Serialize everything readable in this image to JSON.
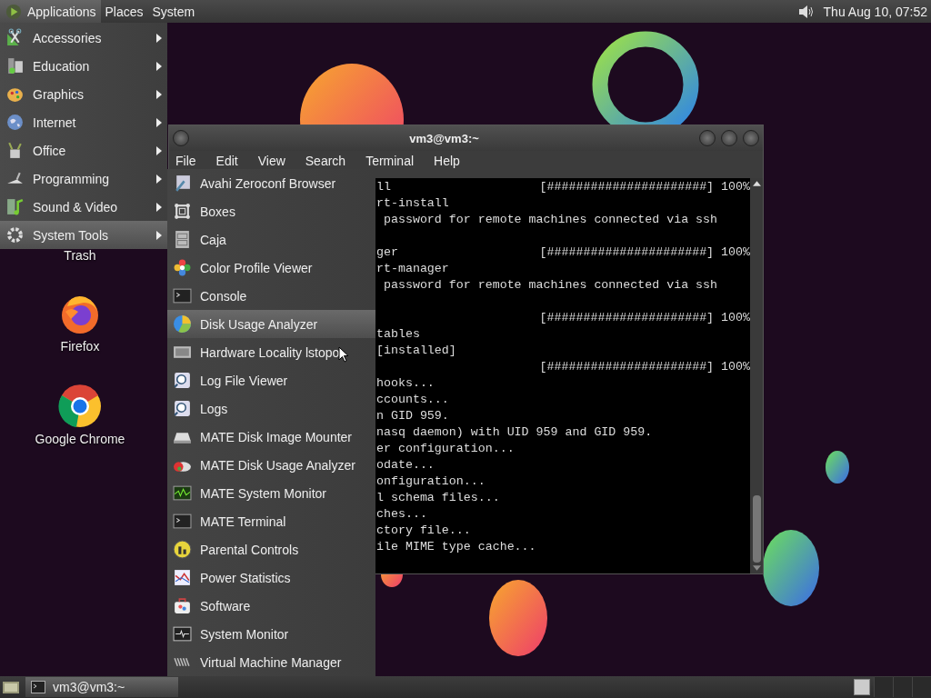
{
  "top_panel": {
    "menus": [
      {
        "label": "Applications",
        "selected": true
      },
      {
        "label": "Places",
        "selected": false
      },
      {
        "label": "System",
        "selected": false
      }
    ],
    "clock": "Thu Aug 10, 07:52"
  },
  "desktop_icons": [
    {
      "label": "Trash"
    },
    {
      "label": "Firefox"
    },
    {
      "label": "Google Chrome"
    }
  ],
  "terminal": {
    "title": "vm3@vm3:~",
    "menus": [
      "File",
      "Edit",
      "View",
      "Search",
      "Terminal",
      "Help"
    ],
    "blocks": [
      {
        "lines": [
          {
            "text": "ll",
            "progress": "[######################] 100%"
          },
          {
            "text": "rt-install"
          },
          {
            "text": " password for remote machines connected via ssh"
          }
        ]
      },
      {
        "lines": [
          {
            "text": "ger",
            "progress": "[######################] 100%"
          },
          {
            "text": "rt-manager"
          },
          {
            "text": " password for remote machines connected via ssh"
          }
        ]
      },
      {
        "lines": [
          {
            "progress": "[######################] 100%"
          },
          {
            "text": "tables"
          },
          {
            "text": "[installed]"
          },
          {
            "progress": "[######################] 100%"
          },
          {
            "text": "hooks..."
          },
          {
            "text": "ccounts..."
          },
          {
            "text": "n GID 959."
          },
          {
            "text": "nasq daemon) with UID 959 and GID 959."
          },
          {
            "text": "er configuration..."
          },
          {
            "text": "odate..."
          },
          {
            "text": "onfiguration..."
          },
          {
            "text": "l schema files..."
          },
          {
            "text": "ches..."
          },
          {
            "text": "ctory file..."
          },
          {
            "text": "ile MIME type cache..."
          }
        ]
      }
    ]
  },
  "applications_menu": {
    "items": [
      {
        "label": "Accessories",
        "selected": false
      },
      {
        "label": "Education",
        "selected": false
      },
      {
        "label": "Graphics",
        "selected": false
      },
      {
        "label": "Internet",
        "selected": false
      },
      {
        "label": "Office",
        "selected": false
      },
      {
        "label": "Programming",
        "selected": false
      },
      {
        "label": "Sound & Video",
        "selected": false
      },
      {
        "label": "System Tools",
        "selected": true
      }
    ]
  },
  "system_tools_menu": {
    "items": [
      {
        "label": "Avahi Zeroconf Browser",
        "selected": false
      },
      {
        "label": "Boxes",
        "selected": false
      },
      {
        "label": "Caja",
        "selected": false
      },
      {
        "label": "Color Profile Viewer",
        "selected": false
      },
      {
        "label": "Console",
        "selected": false
      },
      {
        "label": "Disk Usage Analyzer",
        "selected": true
      },
      {
        "label": "Hardware Locality lstopo",
        "selected": false
      },
      {
        "label": "Log File Viewer",
        "selected": false
      },
      {
        "label": "Logs",
        "selected": false
      },
      {
        "label": "MATE Disk Image Mounter",
        "selected": false
      },
      {
        "label": "MATE Disk Usage Analyzer",
        "selected": false
      },
      {
        "label": "MATE System Monitor",
        "selected": false
      },
      {
        "label": "MATE Terminal",
        "selected": false
      },
      {
        "label": "Parental Controls",
        "selected": false
      },
      {
        "label": "Power Statistics",
        "selected": false
      },
      {
        "label": "Software",
        "selected": false
      },
      {
        "label": "System Monitor",
        "selected": false
      },
      {
        "label": "Virtual Machine Manager",
        "selected": false
      }
    ]
  },
  "taskbar": {
    "windows": [
      {
        "label": "vm3@vm3:~"
      }
    ]
  }
}
